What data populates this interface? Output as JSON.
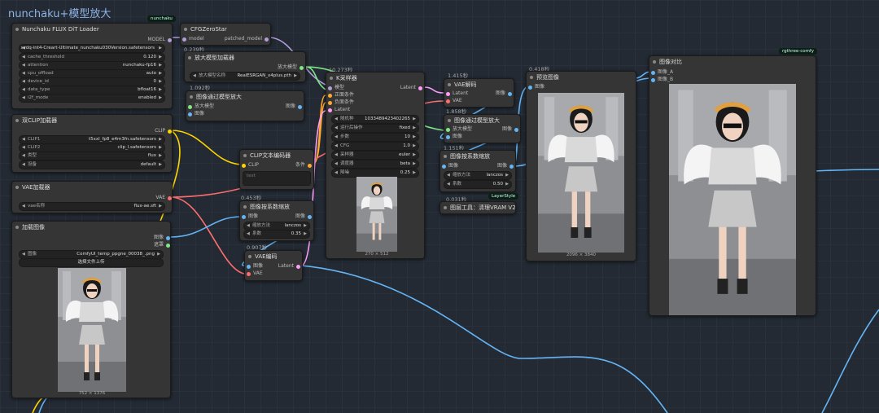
{
  "group": {
    "title": "nunchaku+模型放大"
  },
  "nodes": {
    "flux_loader": {
      "title": "Nunchaku FLUX DiT Loader",
      "badge": "nunchaku",
      "output": "MODEL",
      "widgets": [
        {
          "label": "",
          "value": "svdq-int4-Creart-Ultimate_nunchaku030Version.safetensors"
        },
        {
          "label": "cache_threshold",
          "value": "0.120"
        },
        {
          "label": "attention",
          "value": "nunchaku-fp16"
        },
        {
          "label": "cpu_offload",
          "value": "auto"
        },
        {
          "label": "device_id",
          "value": "0"
        },
        {
          "label": "data_type",
          "value": "bfloat16"
        },
        {
          "label": "i2f_mode",
          "value": "enabled"
        }
      ]
    },
    "cfg_zero": {
      "title": "CFGZeroStar",
      "input": "model",
      "output": "patched_model",
      "time": "0.239秒"
    },
    "upscale_loader": {
      "title": "放大模型加载器",
      "output": "放大模型",
      "widget_label": "放大模型名称",
      "widget_value": "RealESRGAN_x4plus.pth",
      "time": "1.092秒"
    },
    "upscale_by_model": {
      "title": "图像通过模型放大",
      "inputs": [
        "放大模型",
        "图像"
      ],
      "output": "图像"
    },
    "dual_clip": {
      "title": "双CLIP加载器",
      "output": "CLIP",
      "widgets": [
        {
          "label": "CLIP1",
          "value": "t5xxl_fp8_e4m3fn.safetensors"
        },
        {
          "label": "CLIP2",
          "value": "clip_l.safetensors"
        },
        {
          "label": "类型",
          "value": "flux"
        },
        {
          "label": "设备",
          "value": "default"
        }
      ]
    },
    "clip_encode": {
      "title": "CLIP文本编码器",
      "input": "CLIP",
      "output": "条件",
      "placeholder": "text"
    },
    "vae_loader": {
      "title": "VAE加载器",
      "output": "VAE",
      "widget_label": "vae名称",
      "widget_value": "flux-ae.sft"
    },
    "load_image": {
      "title": "加载图像",
      "outputs": [
        "图像",
        "遮罩"
      ],
      "widget_label": "图像",
      "widget_value": "ComfyUI_temp_ppgne_00038_.png",
      "button": "选择文件上传",
      "caption": "752 × 1376"
    },
    "scale_by_1": {
      "title": "图像按系数缩放",
      "time": "0.453秒",
      "input": "图像",
      "output": "图像",
      "widgets": [
        {
          "label": "缩放方法",
          "value": "lanczos"
        },
        {
          "label": "系数",
          "value": "0.35"
        }
      ]
    },
    "vae_encode": {
      "title": "VAE编码",
      "time": "0.907秒",
      "inputs": [
        "图像",
        "VAE"
      ],
      "output": "Latent"
    },
    "ksampler": {
      "title": "K采样器",
      "time": "10.273秒",
      "inputs": [
        "模型",
        "正面条件",
        "负面条件",
        "Latent"
      ],
      "output": "Latent",
      "widgets": [
        {
          "label": "随机种",
          "value": "1033489423402265"
        },
        {
          "label": "运行后操作",
          "value": "fixed"
        },
        {
          "label": "步数",
          "value": "10"
        },
        {
          "label": "CFG",
          "value": "1.0"
        },
        {
          "label": "采样器",
          "value": "euler"
        },
        {
          "label": "调度器",
          "value": "beta"
        },
        {
          "label": "降噪",
          "value": "0.25"
        }
      ],
      "caption": "270 × 512"
    },
    "vae_decode": {
      "title": "VAE解码",
      "time": "1.415秒",
      "inputs": [
        "Latent",
        "VAE"
      ],
      "output": "图像"
    },
    "upscale_by_model_2": {
      "title": "图像通过模型放大",
      "time": "1.858秒",
      "inputs": [
        "放大模型",
        "图像"
      ],
      "output": "图像"
    },
    "scale_by_2": {
      "title": "图像按系数缩放",
      "time": "1.151秒",
      "input": "图像",
      "output": "图像",
      "widgets": [
        {
          "label": "缩放方法",
          "value": "lanczos"
        },
        {
          "label": "系数",
          "value": "0.50"
        }
      ],
      "badge": "LayerStyle",
      "time_after": "0.031秒"
    },
    "purge_vram": {
      "title": "图层工具：清理VRAM V2"
    },
    "preview": {
      "title": "预览图像",
      "time": "0.418秒",
      "input": "图像",
      "caption": "2096 × 3840"
    },
    "compare": {
      "title": "图像对比",
      "badge": "rgthree-comfy",
      "inputs": [
        "图像_A",
        "图像_B"
      ]
    }
  },
  "colors": {
    "model": "#b39ddb",
    "clip": "#ffd500",
    "vae": "#ff6e6e",
    "image": "#64b5f6",
    "latent": "#ff9cf9",
    "conditioning": "#ffa931",
    "upscale": "#7ee787"
  }
}
